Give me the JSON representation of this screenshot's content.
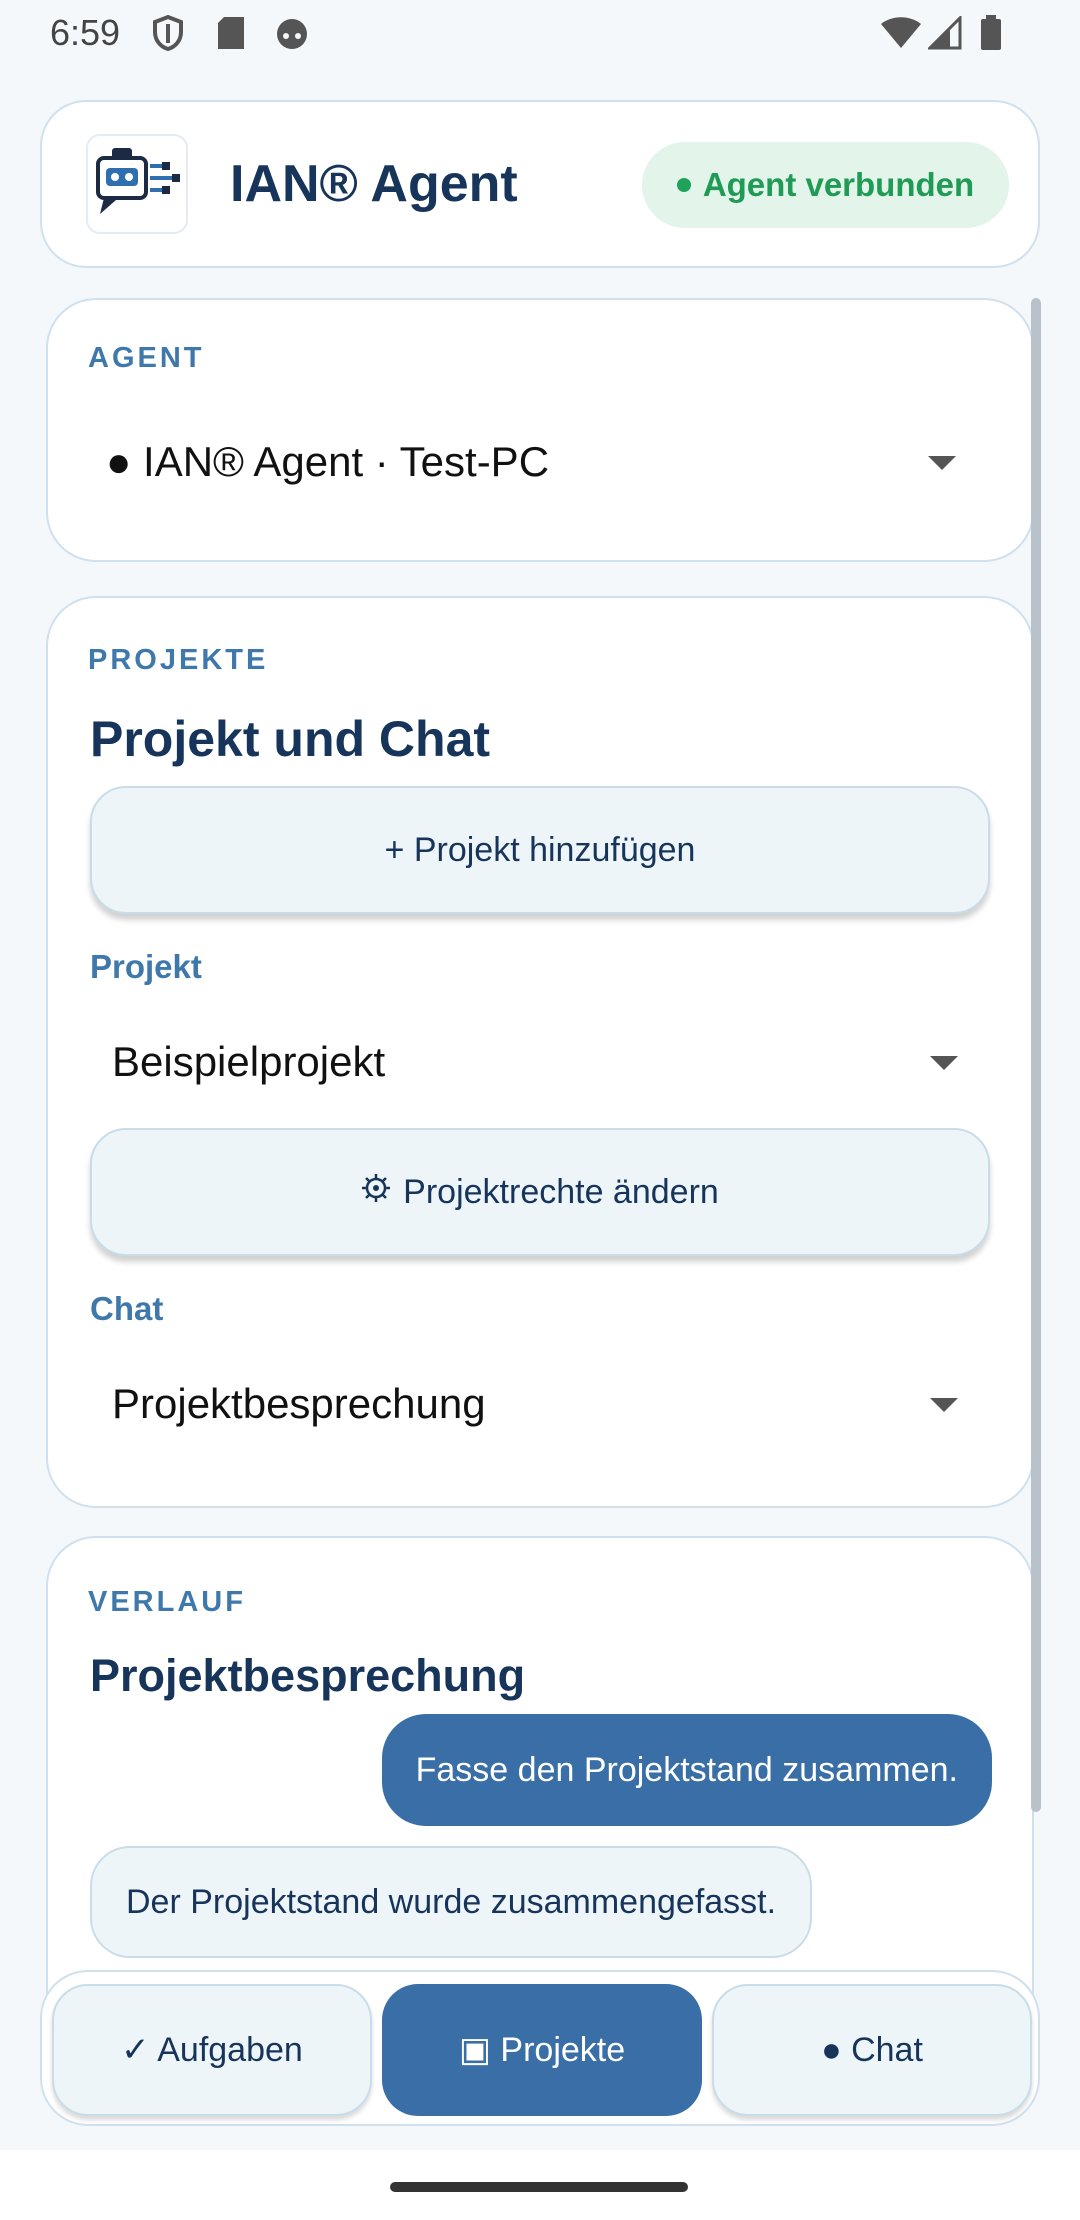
{
  "status_bar": {
    "time": "6:59",
    "left_icons": [
      "shield-icon",
      "sd-card-icon",
      "android-icon"
    ],
    "right_icons": [
      "wifi-icon",
      "signal-icon",
      "battery-icon"
    ]
  },
  "header": {
    "logo": "robot-agent-logo",
    "title": "IAN® Agent",
    "status": "Agent verbunden",
    "status_color": "#1fa35a"
  },
  "agent_card": {
    "label": "AGENT",
    "selected": "● IAN® Agent · Test-PC"
  },
  "projects_card": {
    "label": "PROJEKTE",
    "title": "Projekt und Chat",
    "add_button": "+ Projekt hinzufügen",
    "project_label": "Projekt",
    "project_selected": "Beispielprojekt",
    "rights_button": "Projektrechte ändern",
    "chat_label": "Chat",
    "chat_selected": "Projektbesprechung"
  },
  "history_card": {
    "label": "VERLAUF",
    "title": "Projektbesprechung",
    "messages": [
      {
        "role": "user",
        "text": "Fasse den Projektstand zusammen."
      },
      {
        "role": "agent",
        "text": "Der Projektstand wurde zusammengefasst."
      }
    ]
  },
  "bottom_nav": {
    "items": [
      {
        "label": "✓ Aufgaben",
        "active": false
      },
      {
        "label": "▣ Projekte",
        "active": true
      },
      {
        "label": "● Chat",
        "active": false
      }
    ]
  },
  "colors": {
    "accent": "#396ea6",
    "title": "#17355a",
    "section": "#3f78ab"
  }
}
